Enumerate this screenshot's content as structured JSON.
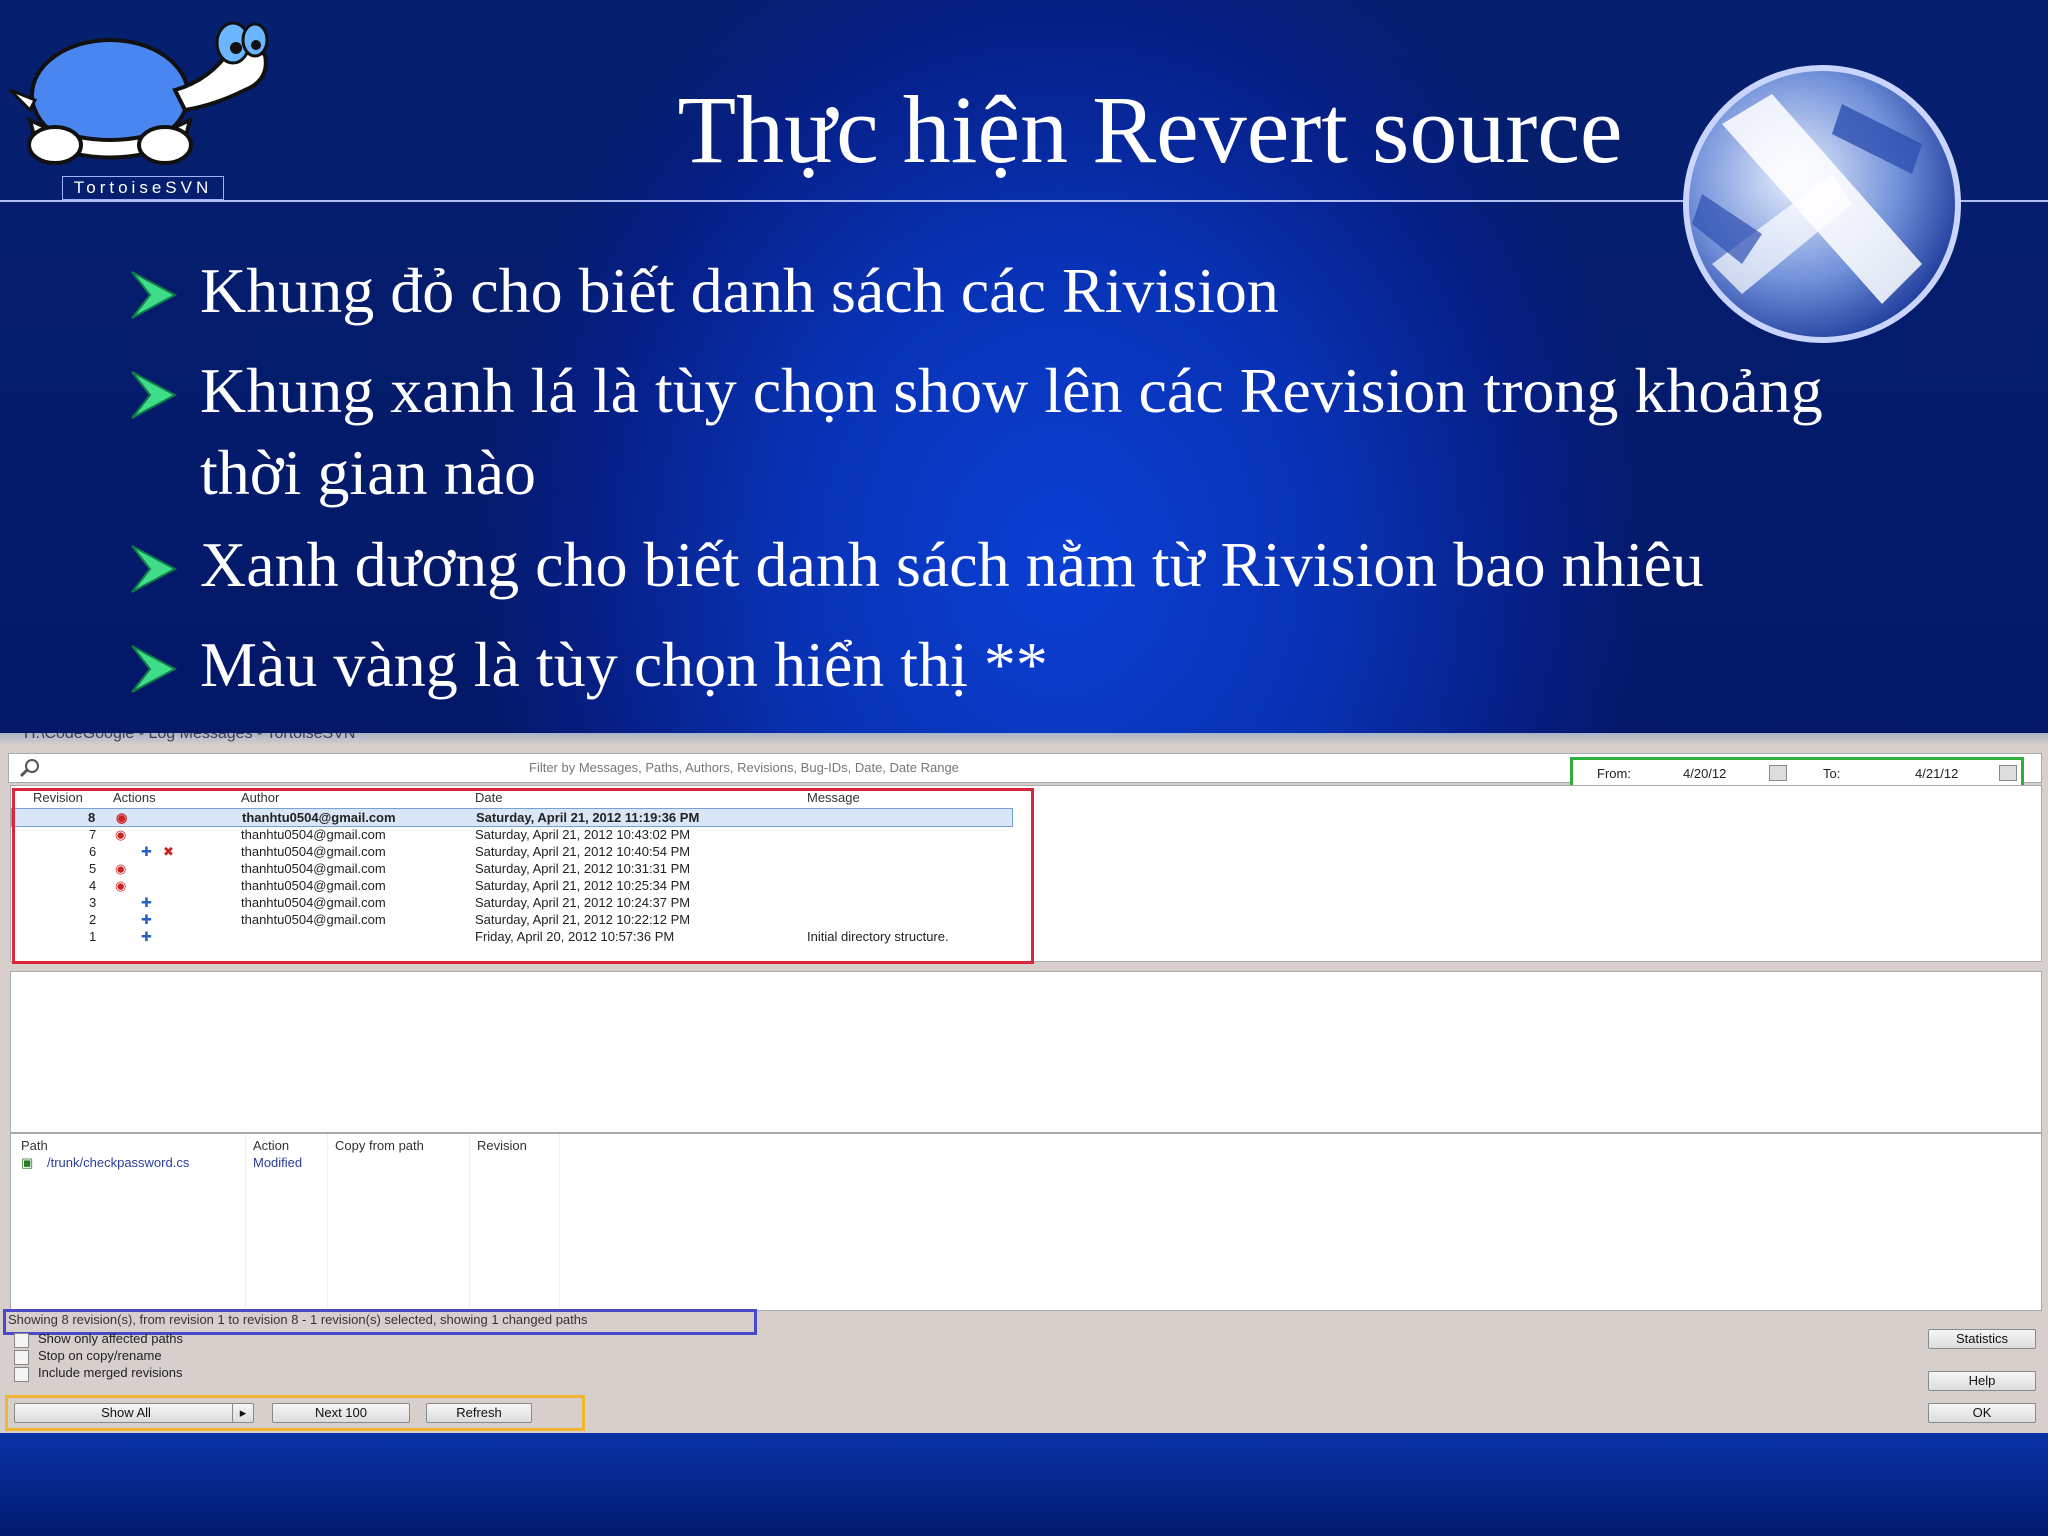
{
  "slide": {
    "title": "Thực hiện Revert source",
    "logo_text": "TortoiseSVN",
    "bullets": [
      "Khung đỏ cho biết danh sách các Rivision",
      "Khung xanh lá là tùy chọn show lên các Revision trong khoảng thời gian nào",
      "Xanh dương cho biết danh sách nằm từ Rivision bao nhiêu",
      "Màu vàng là tùy chọn hiển thị  **"
    ]
  },
  "window": {
    "title": "H:\\CodeGoogle - Log Messages - TortoiseSVN",
    "filter_placeholder": "Filter by Messages, Paths, Authors, Revisions, Bug-IDs, Date, Date Range",
    "from_label": "From:",
    "from_value": "4/20/12",
    "to_label": "To:",
    "to_value": "4/21/12",
    "columns": [
      "Revision",
      "Actions",
      "Author",
      "Date",
      "Message"
    ],
    "rows": [
      {
        "rev": "8",
        "author": "thanhtu0504@gmail.com",
        "date": "Saturday, April 21, 2012 11:19:36 PM",
        "message": ""
      },
      {
        "rev": "7",
        "author": "thanhtu0504@gmail.com",
        "date": "Saturday, April 21, 2012 10:43:02 PM",
        "message": ""
      },
      {
        "rev": "6",
        "author": "thanhtu0504@gmail.com",
        "date": "Saturday, April 21, 2012 10:40:54 PM",
        "message": ""
      },
      {
        "rev": "5",
        "author": "thanhtu0504@gmail.com",
        "date": "Saturday, April 21, 2012 10:31:31 PM",
        "message": ""
      },
      {
        "rev": "4",
        "author": "thanhtu0504@gmail.com",
        "date": "Saturday, April 21, 2012 10:25:34 PM",
        "message": ""
      },
      {
        "rev": "3",
        "author": "thanhtu0504@gmail.com",
        "date": "Saturday, April 21, 2012 10:24:37 PM",
        "message": ""
      },
      {
        "rev": "2",
        "author": "thanhtu0504@gmail.com",
        "date": "Saturday, April 21, 2012 10:22:12 PM",
        "message": ""
      },
      {
        "rev": "1",
        "author": "",
        "date": "Friday, April 20, 2012 10:57:36 PM",
        "message": "Initial directory structure."
      }
    ],
    "path_columns": [
      "Path",
      "Action",
      "Copy from path",
      "Revision"
    ],
    "path_rows": [
      {
        "path": "/trunk/checkpassword.cs",
        "action": "Modified"
      }
    ],
    "status": "Showing 8 revision(s), from revision 1 to revision 8 - 1 revision(s) selected, showing 1 changed paths",
    "checkboxes": [
      "Show only affected paths",
      "Stop on copy/rename",
      "Include merged revisions"
    ],
    "buttons": {
      "show_all": "Show All",
      "next": "Next 100",
      "refresh": "Refresh",
      "statistics": "Statistics",
      "help": "Help",
      "ok": "OK"
    }
  }
}
